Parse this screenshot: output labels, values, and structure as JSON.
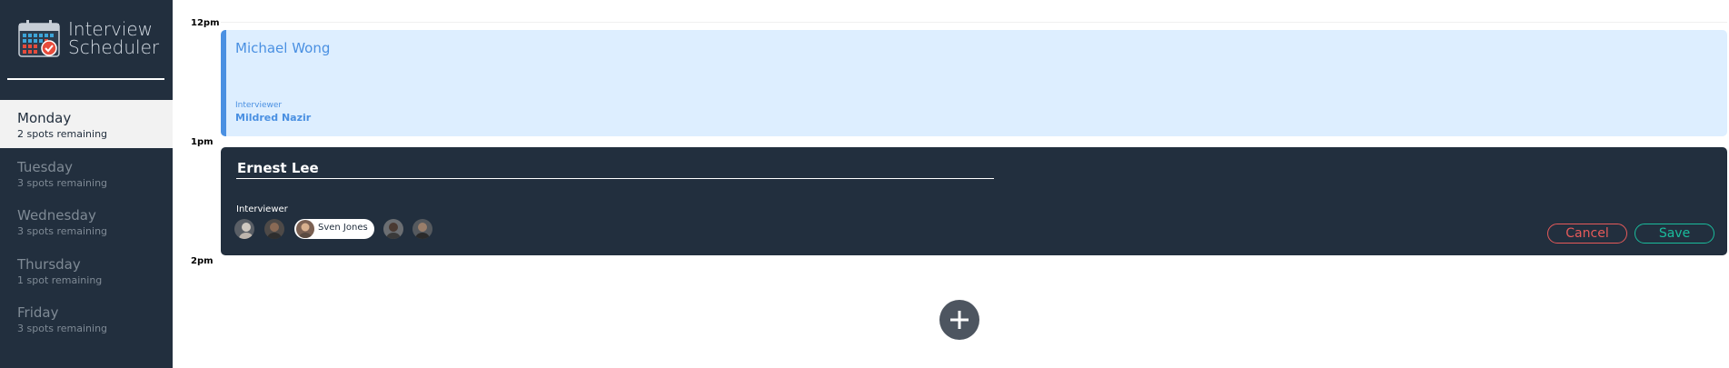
{
  "app": {
    "title_line1": "Interview",
    "title_line2": "Scheduler"
  },
  "sidebar": {
    "days": [
      {
        "name": "Monday",
        "spots": "2 spots remaining",
        "selected": true
      },
      {
        "name": "Tuesday",
        "spots": "3 spots remaining"
      },
      {
        "name": "Wednesday",
        "spots": "3 spots remaining"
      },
      {
        "name": "Thursday",
        "spots": "1 spot remaining"
      },
      {
        "name": "Friday",
        "spots": "3 spots remaining"
      }
    ]
  },
  "schedule": {
    "times": [
      "12pm",
      "1pm",
      "2pm"
    ],
    "booked": {
      "student": "Michael Wong",
      "interviewer_label": "Interviewer",
      "interviewer": "Mildred Nazir"
    },
    "form": {
      "student_value": "Ernest Lee",
      "interviewer_label": "Interviewer",
      "selected_interviewer": "Sven Jones",
      "cancel_label": "Cancel",
      "save_label": "Save"
    }
  },
  "icons": {
    "logo": "calendar-check-icon",
    "add": "plus-icon"
  },
  "colors": {
    "sidebar_bg": "#222f3e",
    "booked_bg": "#ddeeff",
    "booked_accent": "#4a90e2",
    "cancel": "#e65a5a",
    "save": "#1abc9c"
  }
}
